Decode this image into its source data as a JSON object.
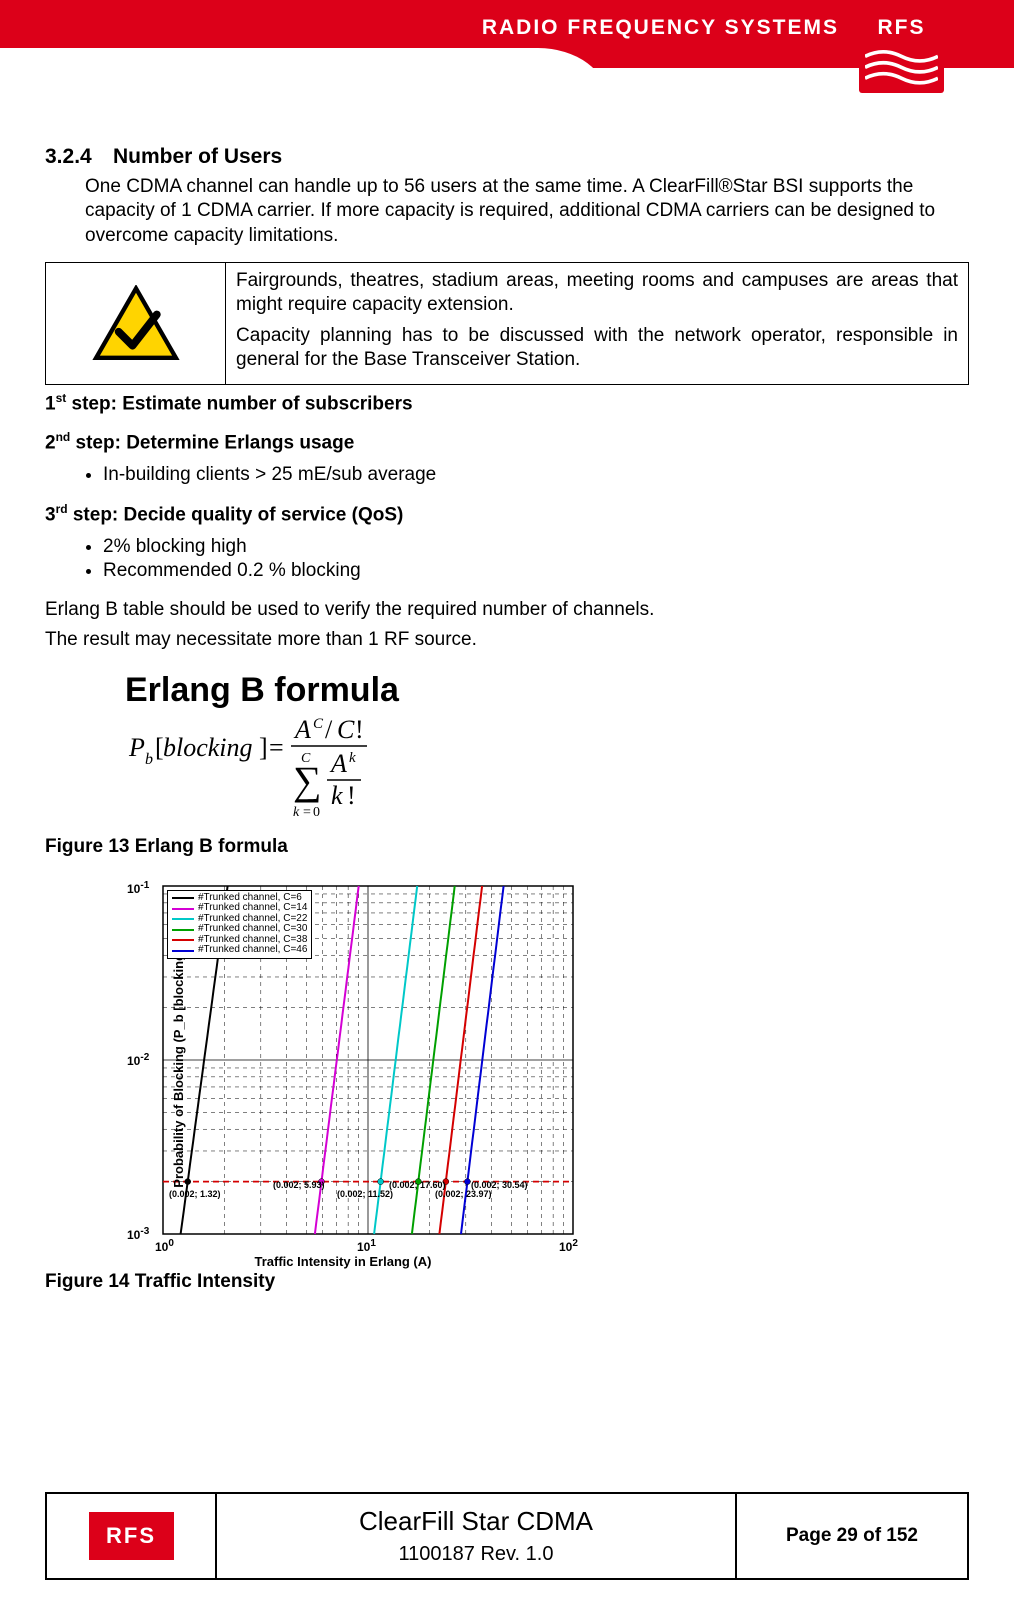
{
  "header": {
    "brand_text": "RADIO FREQUENCY SYSTEMS",
    "logo_text": "RFS"
  },
  "section": {
    "number": "3.2.4",
    "title": "Number of Users",
    "intro": "One CDMA channel can handle up to 56 users at the same time. A ClearFill®Star BSI supports the capacity of 1 CDMA carrier. If more capacity is required, additional CDMA carriers can be designed to overcome capacity limitations."
  },
  "note": {
    "line1": "Fairgrounds, theatres, stadium areas, meeting rooms and campuses are areas that might require capacity extension.",
    "line2": "Capacity planning has to be discussed with the network operator, responsible in general for the Base Transceiver Station."
  },
  "steps": {
    "s1_sup": "st",
    "s1": "1",
    "s1_rest": " step:  Estimate number of subscribers",
    "s2_sup": "nd",
    "s2": "2",
    "s2_rest": " step: Determine Erlangs usage",
    "s2_bullet": "In-building clients > 25 mE/sub average",
    "s3_sup": "rd",
    "s3": "3",
    "s3_rest": " step: Decide quality of service (QoS)",
    "s3_bullets": [
      "2% blocking high",
      "Recommended 0.2 % blocking"
    ]
  },
  "erlang_text": {
    "intro1": "Erlang B table should be used to verify the required number of channels.",
    "intro2": "The result may necessitate more than 1 RF source.",
    "title": "Erlang B formula",
    "caption": "Figure 13 Erlang B formula",
    "lhs_P": "P",
    "lhs_b": "b",
    "br_l": "[",
    "br_r": "]",
    "word": "blocking",
    "eq": "=",
    "A": "A",
    "C": "C",
    "slash": "/",
    "Cfact": "C",
    "bang1": "!",
    "sum": "∑",
    "k0": "k",
    "zero": "0",
    "kexp": "k",
    "kfact": "k",
    "bang2": "!"
  },
  "chart_caption": "Figure 14 Traffic Intensity",
  "chart_data": {
    "type": "line",
    "xlabel": "Traffic Intensity in Erlang (A)",
    "ylabel": "Probability of Blocking (P_b [blocking])",
    "x_scale": "log",
    "y_scale": "log",
    "xlim": [
      1,
      100
    ],
    "ylim": [
      0.001,
      0.1
    ],
    "x_ticks": [
      "10^0",
      "10^1",
      "10^2"
    ],
    "y_ticks": [
      "10^-3",
      "10^-2",
      "10^-1"
    ],
    "marker_line_y": 0.002,
    "series": [
      {
        "name": "#Trunked channel, C=6",
        "color": "#000000",
        "marker_x": 1.32
      },
      {
        "name": "#Trunked channel, C=14",
        "color": "#d400d4",
        "marker_x": 5.93
      },
      {
        "name": "#Trunked channel, C=22",
        "color": "#00c8c8",
        "marker_x": 11.52
      },
      {
        "name": "#Trunked channel, C=30",
        "color": "#00a000",
        "marker_x": 17.6
      },
      {
        "name": "#Trunked channel, C=38",
        "color": "#d40000",
        "marker_x": 23.97
      },
      {
        "name": "#Trunked channel, C=46",
        "color": "#0000d4",
        "marker_x": 30.54
      }
    ],
    "marker_labels": [
      "(0.002; 1.32)",
      "(0.002; 5.93)",
      "(0.002; 11.52)",
      "(0.002; 17.60)",
      "(0.002; 23.97)",
      "(0.002; 30.54)"
    ]
  },
  "footer": {
    "logo_text": "RFS",
    "title": "ClearFill Star CDMA",
    "rev": "1100187 Rev. 1.0",
    "page": "Page 29 of 152"
  }
}
